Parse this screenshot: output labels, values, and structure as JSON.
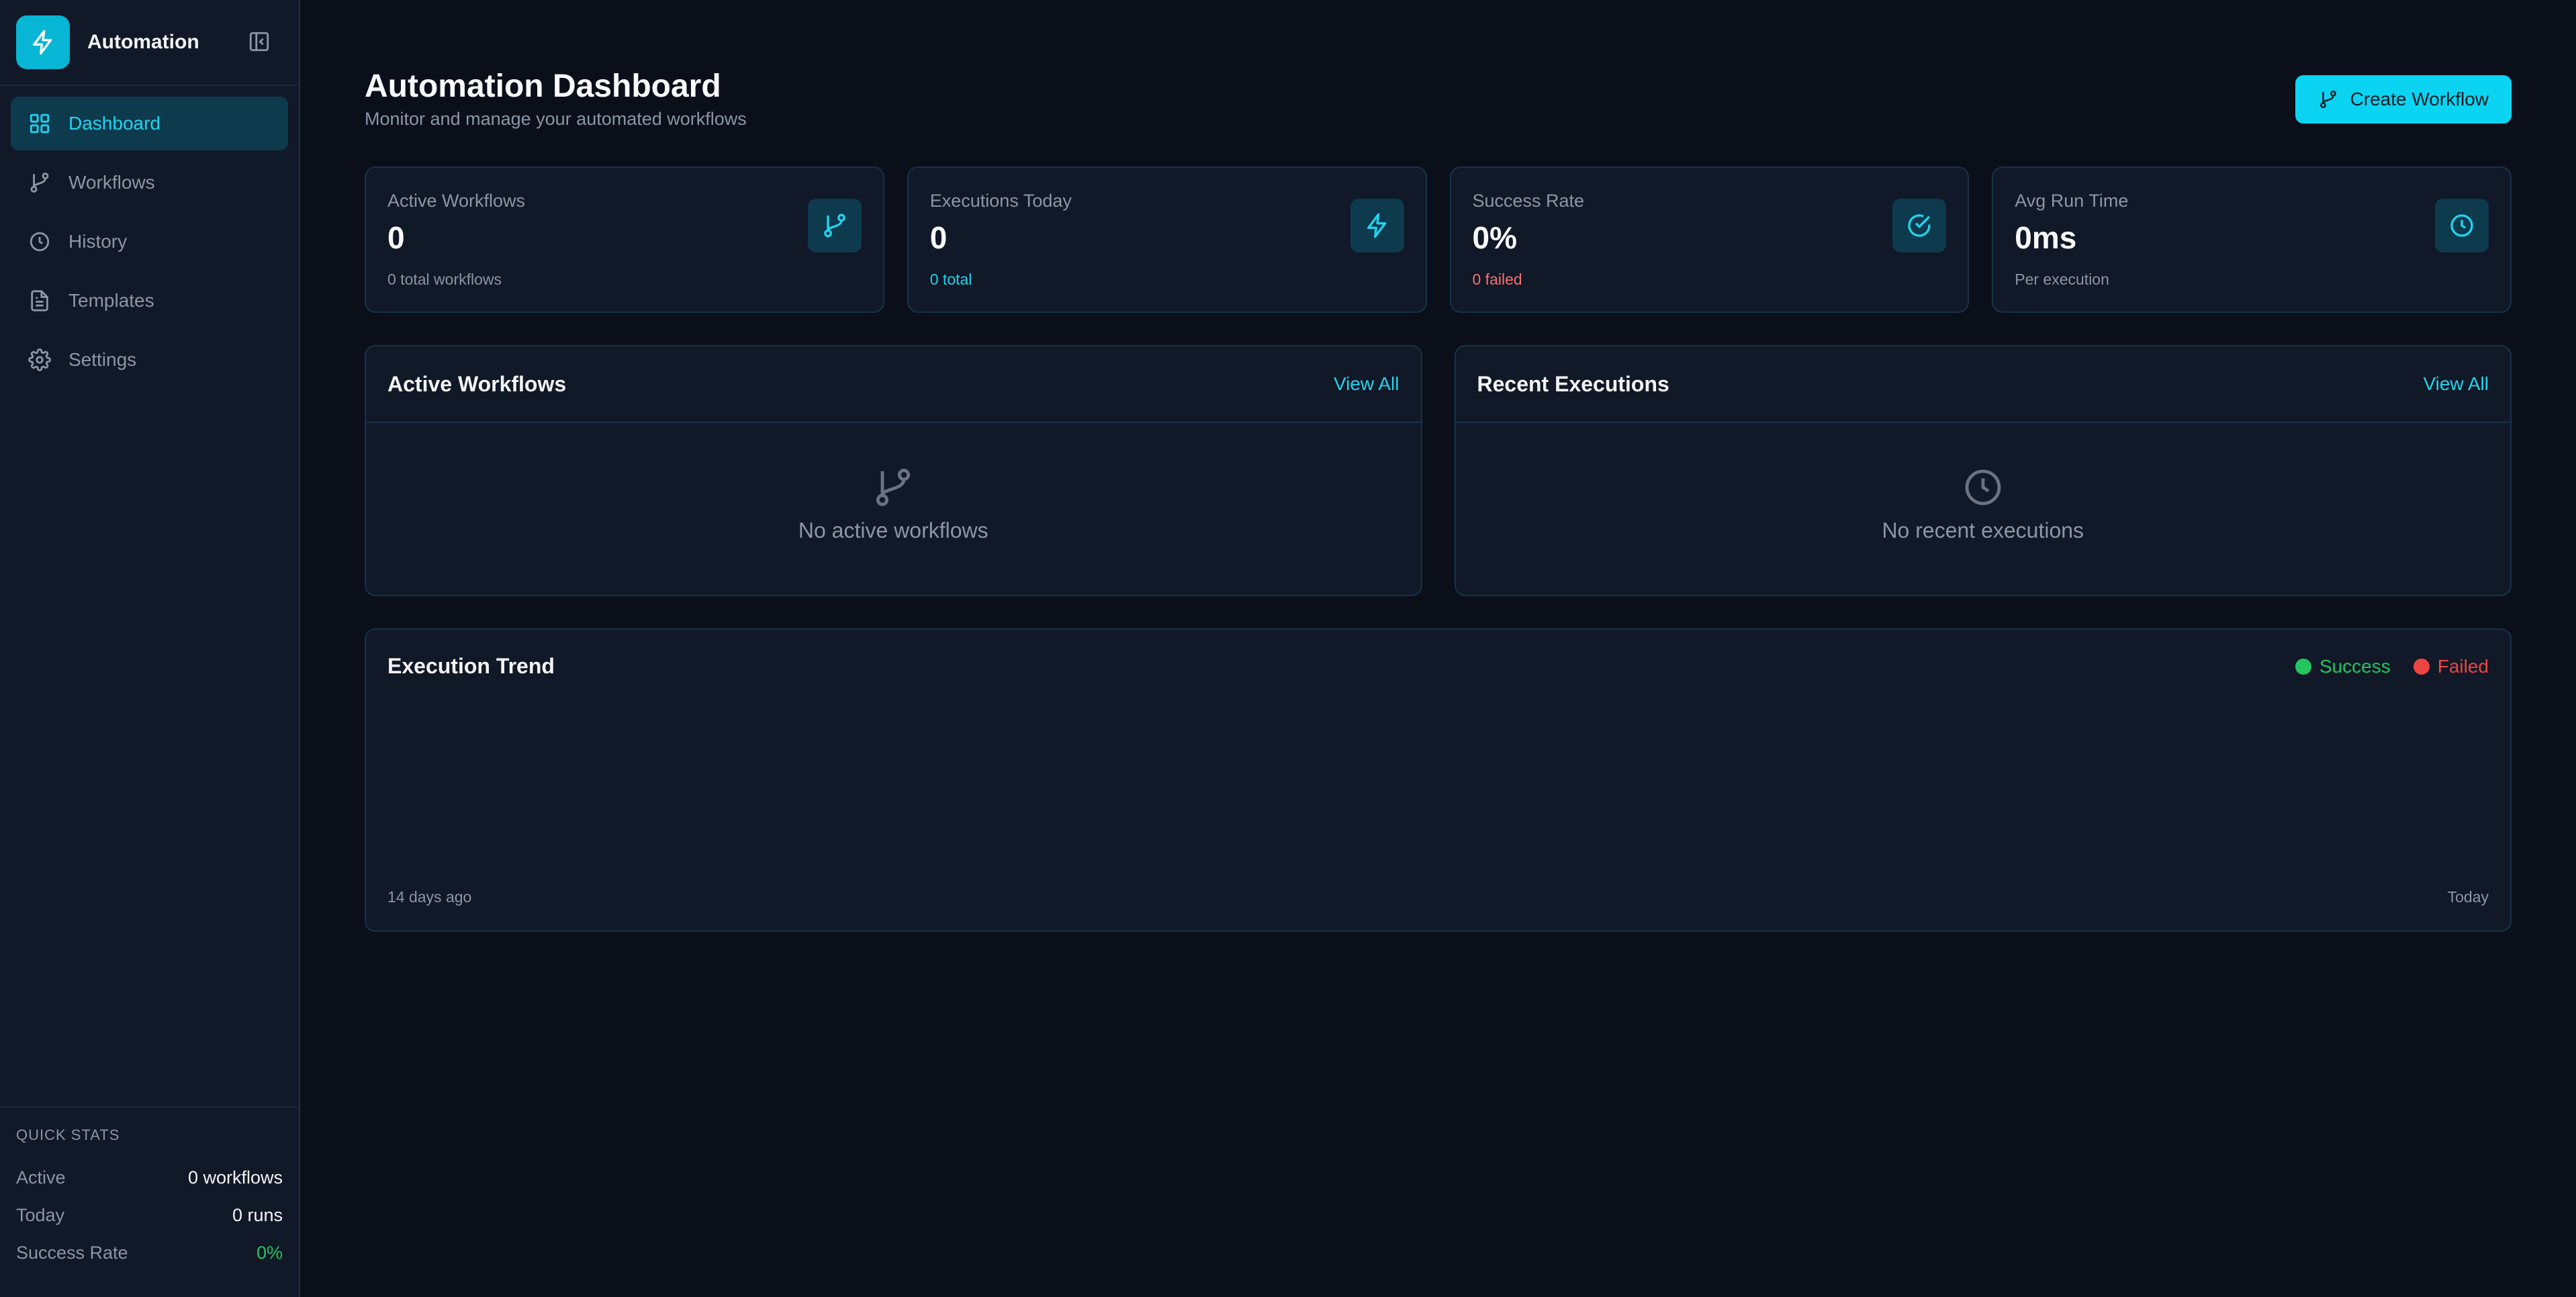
{
  "app": {
    "name": "Automation"
  },
  "sidebar": {
    "items": [
      {
        "label": "Dashboard"
      },
      {
        "label": "Workflows"
      },
      {
        "label": "History"
      },
      {
        "label": "Templates"
      },
      {
        "label": "Settings"
      }
    ],
    "quick_stats": {
      "title": "QUICK STATS",
      "rows": [
        {
          "label": "Active",
          "value": "0 workflows"
        },
        {
          "label": "Today",
          "value": "0 runs"
        },
        {
          "label": "Success Rate",
          "value": "0%"
        }
      ]
    }
  },
  "header": {
    "title": "Automation Dashboard",
    "subtitle": "Monitor and manage your automated workflows",
    "create_label": "Create Workflow"
  },
  "stats": [
    {
      "label": "Active Workflows",
      "value": "0",
      "sub": "0 total workflows"
    },
    {
      "label": "Executions Today",
      "value": "0",
      "sub": "0 total"
    },
    {
      "label": "Success Rate",
      "value": "0%",
      "sub": "0 failed"
    },
    {
      "label": "Avg Run Time",
      "value": "0ms",
      "sub": "Per execution"
    }
  ],
  "panels": {
    "active_workflows": {
      "title": "Active Workflows",
      "view_all": "View All",
      "empty": "No active workflows"
    },
    "recent_executions": {
      "title": "Recent Executions",
      "view_all": "View All",
      "empty": "No recent executions"
    }
  },
  "trend": {
    "title": "Execution Trend",
    "legend": [
      {
        "label": "Success",
        "color": "#22c55e"
      },
      {
        "label": "Failed",
        "color": "#ef4444"
      }
    ],
    "axis_start": "14 days ago",
    "axis_end": "Today"
  },
  "colors": {
    "accent": "#22d3ee",
    "success": "#22c55e",
    "danger": "#ef4444"
  }
}
